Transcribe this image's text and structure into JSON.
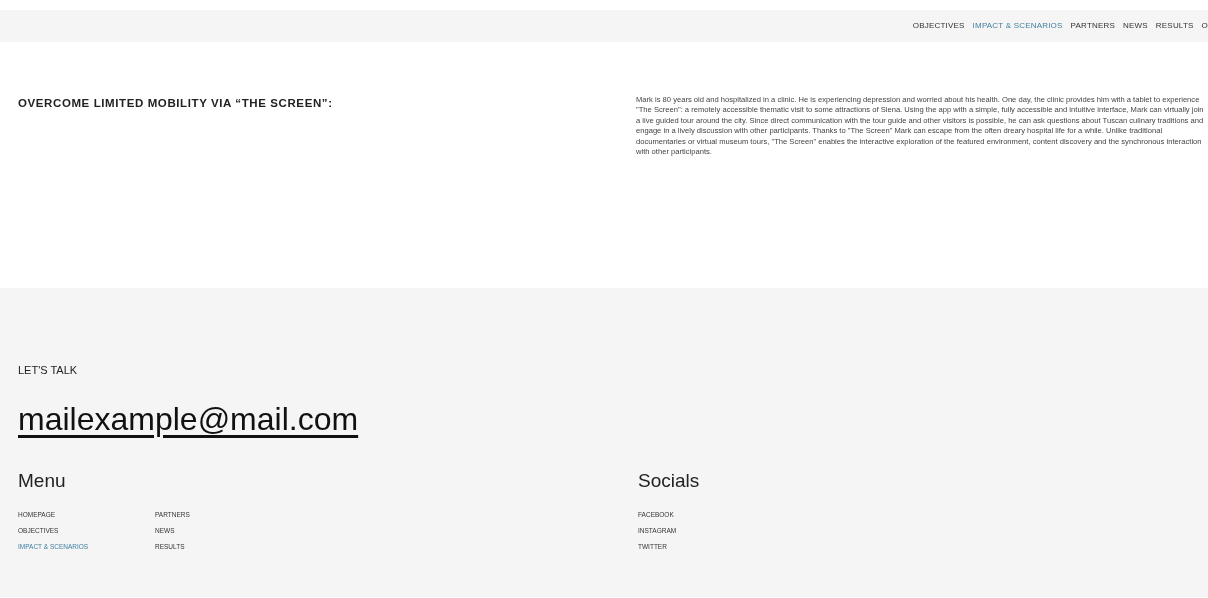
{
  "nav": [
    {
      "label": "OBJECTIVES",
      "selected": false
    },
    {
      "label": "IMPACT & SCENARIOS",
      "selected": true
    },
    {
      "label": "PARTNERS",
      "selected": false
    },
    {
      "label": "NEWS",
      "selected": false
    },
    {
      "label": "RESULTS",
      "selected": false
    },
    {
      "label": "O",
      "selected": false
    }
  ],
  "scenario": {
    "title": "OVERCOME LIMITED MOBILITY VIA “THE SCREEN”:",
    "text": "Mark is 80 years old and hospitalized in a clinic. He is experiencing depression and worried about his health. One day, the clinic provides him with a tablet to experience \"The Screen\": a remotely accessible thematic visit to some attractions of Siena. Using the app with a simple, fully accessible and intuitive interface, Mark can virtually join a live guided tour around the city. Since direct communication with the tour guide and other visitors is possible, he can ask questions about Tuscan culinary traditions and engage in a lively discussion with other participants. Thanks to \"The Screen\" Mark can escape from the often dreary hospital life for a while. Unlike traditional documentaries or virtual museum tours, \"The Screen\" enables the interactive exploration of the featured environment, content discovery and the synchronous interaction with other participants."
  },
  "footer": {
    "talk_label": "LET'S TALK",
    "email": "mailexample@mail.com",
    "menu_title": "Menu",
    "menu": [
      {
        "label": "HOMEPAGE",
        "selected": false
      },
      {
        "label": "OBJECTIVES",
        "selected": false
      },
      {
        "label": "IMPACT & SCENARIOS",
        "selected": true
      },
      {
        "label": "PARTNERS",
        "selected": false
      },
      {
        "label": "NEWS",
        "selected": false
      },
      {
        "label": "RESULTS",
        "selected": false
      }
    ],
    "socials_title": "Socials",
    "socials": [
      "FACEBOOK",
      "INSTAGRAM",
      "TWITTER"
    ]
  }
}
